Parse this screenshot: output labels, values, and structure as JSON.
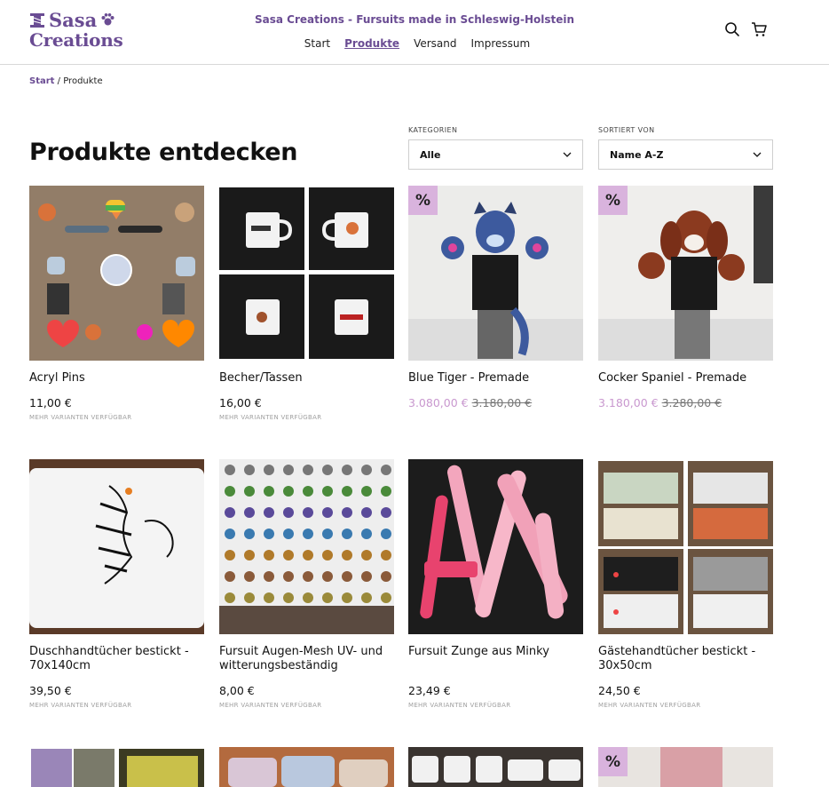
{
  "brand": {
    "line1": "Sasa",
    "line2": "Creations"
  },
  "tagline": "Sasa Creations - Fursuits made in Schleswig-Holstein",
  "nav": [
    {
      "label": "Start",
      "active": false
    },
    {
      "label": "Produkte",
      "active": true
    },
    {
      "label": "Versand",
      "active": false
    },
    {
      "label": "Impressum",
      "active": false
    }
  ],
  "icons": {
    "search": "search-icon",
    "cart": "cart-icon"
  },
  "breadcrumb": {
    "home": "Start",
    "separator": "/",
    "current": "Produkte"
  },
  "page_title": "Produkte entdecken",
  "filters": {
    "category": {
      "label": "KATEGORIEN",
      "value": "Alle"
    },
    "sort": {
      "label": "SORTIERT VON",
      "value": "Name A-Z"
    }
  },
  "sale_badge": "%",
  "variants_text": "MEHR VARIANTEN VERFÜGBAR",
  "products": [
    {
      "name": "Acryl Pins",
      "price": "11,00 €",
      "variants": true,
      "sale": false,
      "image": "acryl-pins-image"
    },
    {
      "name": "Becher/Tassen",
      "price": "16,00 €",
      "variants": true,
      "sale": false,
      "image": "mugs-image"
    },
    {
      "name": "Blue Tiger - Premade",
      "price": "3.080,00 €",
      "old_price": "3.180,00 €",
      "variants": false,
      "sale": true,
      "image": "blue-tiger-fursuit-image"
    },
    {
      "name": "Cocker Spaniel - Premade",
      "price": "3.180,00 €",
      "old_price": "3.280,00 €",
      "variants": false,
      "sale": true,
      "image": "cocker-spaniel-fursuit-image"
    },
    {
      "name": "Duschhandtücher bestickt - 70x140cm",
      "price": "39,50 €",
      "variants": true,
      "sale": false,
      "image": "embroidered-towel-image"
    },
    {
      "name": "Fursuit Augen-Mesh UV- und witterungsbeständig",
      "price": "8,00 €",
      "variants": true,
      "sale": false,
      "image": "eye-mesh-image"
    },
    {
      "name": "Fursuit Zunge aus Minky",
      "price": "23,49 €",
      "variants": true,
      "sale": false,
      "image": "minky-tongue-image"
    },
    {
      "name": "Gästehandtücher bestickt - 30x50cm",
      "price": "24,50 €",
      "variants": true,
      "sale": false,
      "image": "guest-towels-image"
    }
  ],
  "colors": {
    "brand": "#6a4c93",
    "sale_badge": "#d9b3dd",
    "sale_price": "#c998cf"
  }
}
